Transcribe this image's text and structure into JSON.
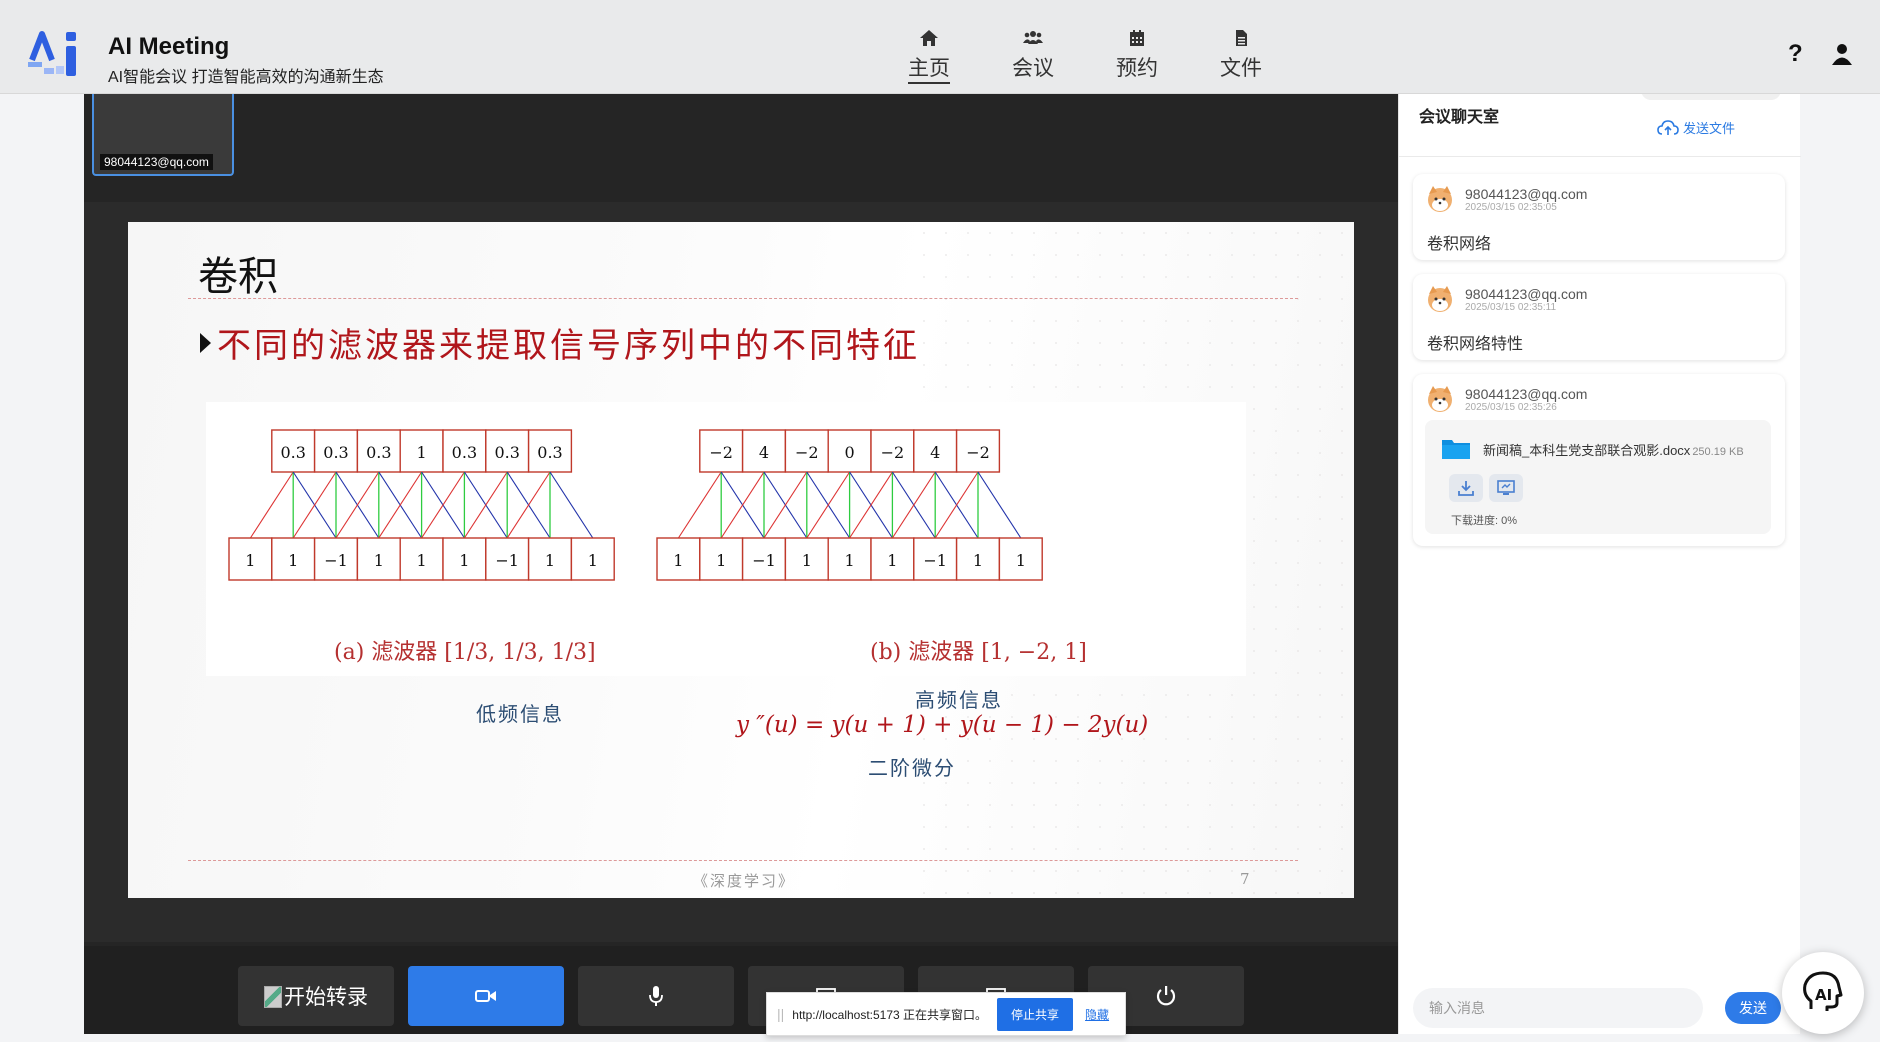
{
  "header": {
    "title": "AI Meeting",
    "subtitle": "AI智能会议 打造智能高效的沟通新生态",
    "nav": [
      {
        "label": "主页",
        "icon": "home-icon",
        "active": true
      },
      {
        "label": "会议",
        "icon": "users-icon",
        "active": false
      },
      {
        "label": "预约",
        "icon": "calendar-icon",
        "active": false
      },
      {
        "label": "文件",
        "icon": "file-icon",
        "active": false
      }
    ],
    "help": "?"
  },
  "video": {
    "participant_label": "98044123@qq.com"
  },
  "slide": {
    "title": "卷积",
    "bullet": "不同的滤波器来提取信号序列中的不同特征",
    "left_filter": {
      "top_values": [
        "0.3",
        "0.3",
        "0.3",
        "1",
        "0.3",
        "0.3",
        "0.3"
      ],
      "bottom_values": [
        "1",
        "1",
        "−1",
        "1",
        "1",
        "1",
        "−1",
        "1",
        "1"
      ],
      "caption": "(a) 滤波器 [1/3, 1/3, 1/3]",
      "note": "低频信息"
    },
    "right_filter": {
      "top_values": [
        "−2",
        "4",
        "−2",
        "0",
        "−2",
        "4",
        "−2"
      ],
      "bottom_values": [
        "1",
        "1",
        "−1",
        "1",
        "1",
        "1",
        "−1",
        "1",
        "1"
      ],
      "caption": "(b) 滤波器 [1, −2, 1]",
      "note_top": "高频信息",
      "formula": "y ″(u)  =  y(u  +  1)  +  y(u  −  1)  −  2y(u)",
      "note_bottom": "二阶微分"
    },
    "footer": "《深度学习》",
    "page": "7"
  },
  "controls": {
    "record_label": "开始转录",
    "camera_icon": "video-camera-icon",
    "mic_icon": "microphone-icon",
    "power_icon": "power-icon"
  },
  "share_bar": {
    "text": "http://localhost:5173 正在共享窗口。",
    "stop_label": "停止共享",
    "hide_label": "隐藏"
  },
  "chat": {
    "title": "会议聊天室",
    "send_file": "发送文件",
    "messages": [
      {
        "user": "98044123@qq.com",
        "time": "2025/03/15 02:35:05",
        "text": "卷积网络"
      },
      {
        "user": "98044123@qq.com",
        "time": "2025/03/15 02:35:11",
        "text": "卷积网络特性"
      },
      {
        "user": "98044123@qq.com",
        "time": "2025/03/15 02:35:26",
        "file_name": "新闻稿_本科生党支部联合观影.docx",
        "file_size": "250.19 KB",
        "progress": "下载进度: 0%"
      }
    ],
    "input_placeholder": "输入消息",
    "send_label": "发送"
  },
  "colors": {
    "accent": "#2e7be8",
    "slide_red": "#b0161b",
    "slide_blue_note": "#2c4d73"
  }
}
